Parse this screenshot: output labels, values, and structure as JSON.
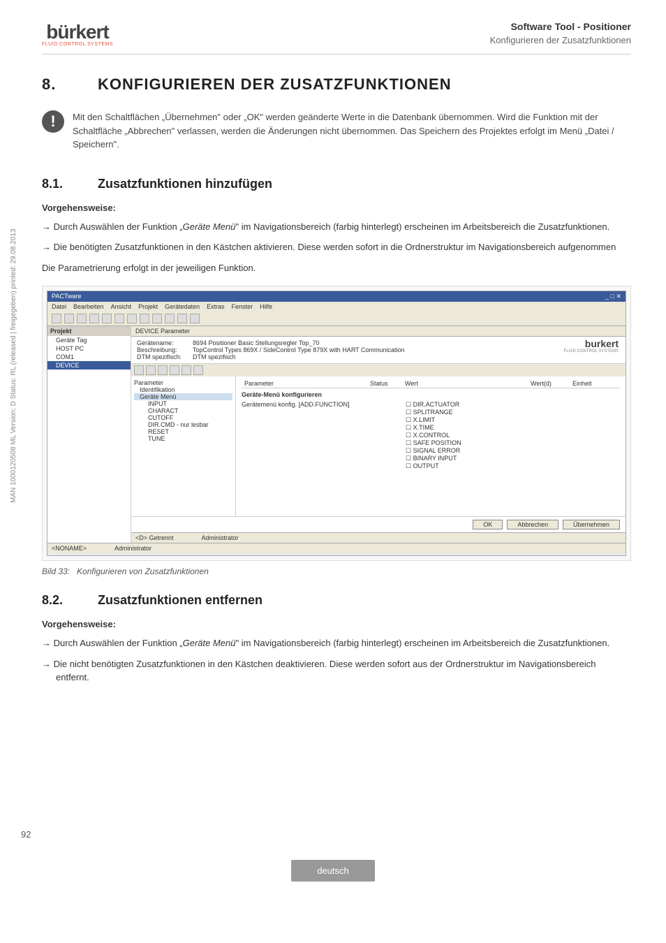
{
  "header": {
    "logo_text": "bürkert",
    "logo_sub": "FLUID CONTROL SYSTEMS",
    "title": "Software Tool - Positioner",
    "subtitle": "Konfigurieren der Zusatzfunktionen"
  },
  "h1": {
    "num": "8.",
    "text": "KONFIGURIEREN DER ZUSATZFUNKTIONEN"
  },
  "infobox": "Mit den Schaltflächen „Übernehmen\" oder „OK\" werden geänderte Werte in die Datenbank übernommen. Wird die Funktion mit der Schaltfläche „Abbrechen\" verlassen, werden die Änderungen nicht übernommen. Das Speichern des Projektes erfolgt im Menü „Datei / Speichern\".",
  "s81": {
    "num": "8.1.",
    "title": "Zusatzfunktionen hinzufügen",
    "proc": "Vorgehensweise:",
    "p1a": "Durch Auswählen der Funktion „",
    "p1i": "Geräte Menü",
    "p1b": "\" im Navigationsbereich (farbig hinterlegt) erscheinen im Arbeitsbereich die Zusatzfunktionen.",
    "p2": "Die benötigten Zusatzfunktionen in den Kästchen aktivieren. Diese werden sofort in die Ordnerstruktur im Navigationsbereich aufgenommen",
    "p3": "Die Parametrierung erfolgt in der jeweiligen Funktion."
  },
  "caption": {
    "lbl": "Bild 33:",
    "txt": "Konfigurieren von Zusatzfunktionen"
  },
  "s82": {
    "num": "8.2.",
    "title": "Zusatzfunktionen entfernen",
    "proc": "Vorgehensweise:",
    "p1a": "Durch Auswählen der Funktion „",
    "p1i": "Geräte Menü",
    "p1b": "\" im Navigationsbereich (farbig hinterlegt) erscheinen im Arbeitsbereich die Zusatzfunktionen.",
    "p2": "Die nicht benötigten Zusatzfunktionen in den Kästchen deaktivieren. Diese werden sofort aus der Ordnerstruktur im Navigationsbereich entfernt."
  },
  "sidebar": "MAN  1000120508  ML  Version: D  Status: RL (released | freigegeben)  printed: 29.08.2013",
  "page_num": "92",
  "footer": "deutsch",
  "shot": {
    "title": "PACTware",
    "menus": [
      "Datei",
      "Bearbeiten",
      "Ansicht",
      "Projekt",
      "Gerätedaten",
      "Extras",
      "Fenster",
      "Hilfe"
    ],
    "nav_hdr": "Projekt",
    "nav": [
      "Geräte Tag",
      "HOST PC",
      "COM1",
      "DEVICE"
    ],
    "tab": "DEVICE Parameter",
    "info": {
      "l1a": "Gerätename:",
      "l1b": "8694 Positioner Basic Stellungsregler Top_70",
      "l2a": "Beschreibung:",
      "l2b": "TopControl Types 869X / SideControl Type 879X with HART Communication",
      "l3a": "DTM spezifisch:",
      "l3b": "DTM spezifisch"
    },
    "logo": "burkert",
    "logo_sub": "FLUID CONTROL SYSTEMS",
    "tree_hdr": "Parameter",
    "tree": [
      "Identifikation",
      "Geräte Menü",
      "INPUT",
      "CHARACT",
      "CUTOFF",
      "DIR.CMD - nur lesbar",
      "RESET",
      "TUNE"
    ],
    "param_cols": [
      "Parameter",
      "Status",
      "Wert",
      "Wert(d)",
      "Einheit"
    ],
    "param_title": "Geräte-Menü konfigurieren",
    "param_label": "Gerätemenü konfig. [ADD.FUNCTION]",
    "checks": [
      "DIR.ACTUATOR",
      "SPLITRANGE",
      "X.LIMIT",
      "X.TIME",
      "X.CONTROL",
      "SAFE POSITION",
      "SIGNAL ERROR",
      "BINARY INPUT",
      "OUTPUT"
    ],
    "btns": {
      "ok": "OK",
      "cancel": "Abbrechen",
      "apply": "Übernehmen"
    },
    "status": {
      "s1": "<D> Getrennt",
      "s2": "Administrator",
      "s3": "<NONAME>",
      "s4": "Administrator"
    }
  }
}
